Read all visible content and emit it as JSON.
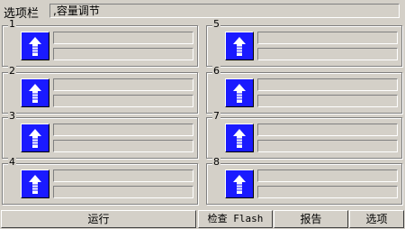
{
  "toolbar": {
    "label": "选项栏",
    "field_value": ",容量调节"
  },
  "panels": [
    {
      "id": "1"
    },
    {
      "id": "2"
    },
    {
      "id": "3"
    },
    {
      "id": "4"
    },
    {
      "id": "5"
    },
    {
      "id": "6"
    },
    {
      "id": "7"
    },
    {
      "id": "8"
    }
  ],
  "buttons": {
    "run": "运行",
    "check_flash": "检查 Flash",
    "report": "报告",
    "options": "选项"
  },
  "icons": {
    "panel_icon": "up-arrow-icon",
    "panel_icon_bg": "#1a1aff"
  }
}
